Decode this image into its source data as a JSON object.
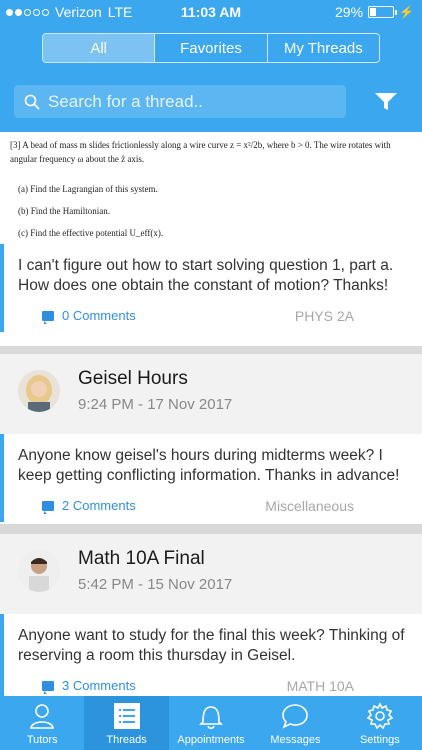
{
  "status": {
    "carrier": "Verizon",
    "network": "LTE",
    "time": "11:03 AM",
    "battery": "29%"
  },
  "segmented": [
    "All",
    "Favorites",
    "My Threads"
  ],
  "search": {
    "placeholder": "Search for a thread.."
  },
  "problem": {
    "header": "[3] A bead of mass m slides frictionlessly along a wire curve z = x²/2b, where b > 0. The wire rotates with angular frequency ω about the ẑ axis.",
    "parts": [
      "(a) Find the Lagrangian of this system.",
      "(b) Find the Hamiltonian.",
      "(c) Find the effective potential U_eff(x)."
    ]
  },
  "posts": [
    {
      "text": "I can't figure out how to start solving question 1, part a. How does one obtain the constant of motion? Thanks!",
      "comments": "0 Comments",
      "tag": "PHYS 2A"
    },
    {
      "title": "Geisel Hours",
      "date": "9:24 PM - 17 Nov 2017",
      "text": "Anyone know geisel's hours during midterms week? I keep getting conflicting information. Thanks in advance!",
      "comments": "2 Comments",
      "tag": "Miscellaneous"
    },
    {
      "title": "Math 10A Final",
      "date": "5:42 PM - 15 Nov 2017",
      "text": "Anyone want to study for the final this week? Thinking of reserving a room this thursday in Geisel.",
      "comments": "3 Comments",
      "tag": "MATH 10A"
    }
  ],
  "tabs": [
    "Tutors",
    "Threads",
    "Appointments",
    "Messages",
    "Settings"
  ],
  "colors": {
    "primary": "#3aa7ee",
    "accent": "#2f8ee0"
  }
}
